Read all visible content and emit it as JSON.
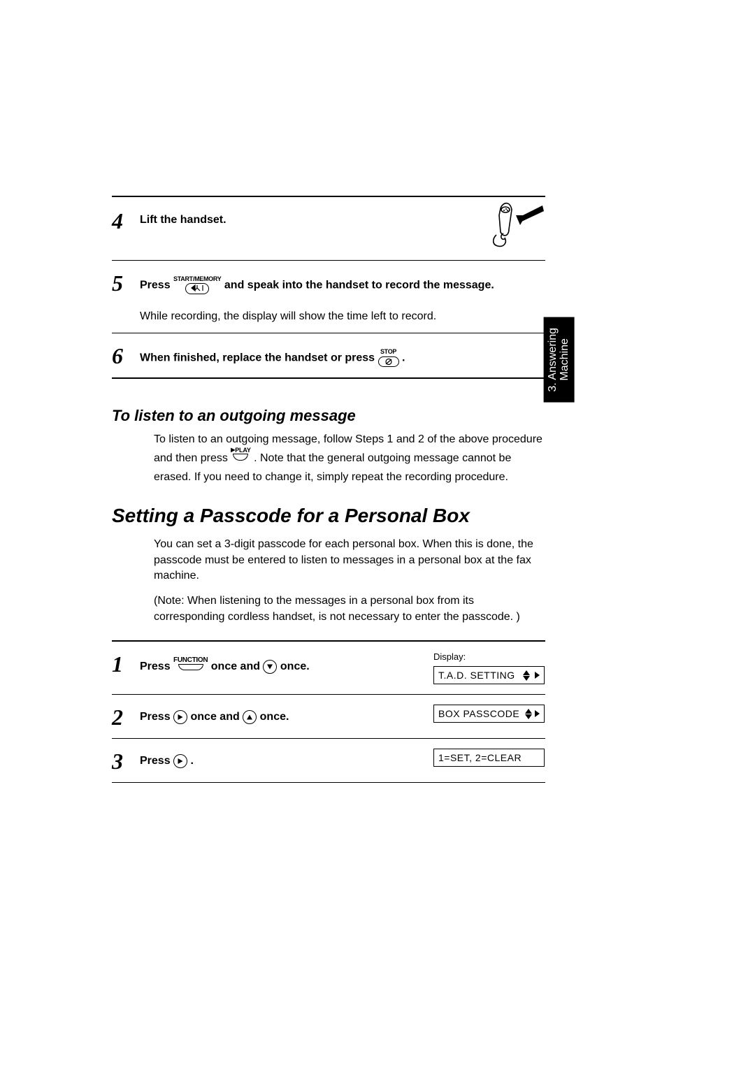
{
  "sideTab": {
    "line1": "3. Answering",
    "line2": "Machine"
  },
  "steps456": {
    "s4": {
      "num": "4",
      "text": "Lift the handset."
    },
    "s5": {
      "num": "5",
      "pre": "Press ",
      "keyLabel": "START/MEMORY",
      "post": " and speak into the handset to record the message.",
      "sub": "While recording, the display will show the time left to record."
    },
    "s6": {
      "num": "6",
      "pre": "When finished, replace the handset or press ",
      "keyLabel": "STOP",
      "post": " ."
    }
  },
  "listenHeading": "To listen to an outgoing message",
  "listenPara": {
    "pre": "To listen to an outgoing message, follow Steps 1 and 2 of the above procedure and then press ",
    "playLabel": "PLAY",
    "post": ". Note that the general outgoing message cannot be erased. If you need to change it, simply repeat the recording procedure."
  },
  "mainHeading": "Setting a Passcode for a Personal Box",
  "mainPara1": "You can set a 3-digit passcode for each personal box. When this is done, the passcode must be entered to listen to messages in a personal box at the fax machine.",
  "mainPara2": "(Note: When listening to the messages in a personal box from its corresponding cordless handset, is not necessary to enter the passcode. )",
  "steps123": {
    "s1": {
      "num": "1",
      "t1": "Press ",
      "funcLabel": "FUNCTION",
      "t2": " once and ",
      "t3": " once.",
      "displayLabel": "Display:",
      "displayText": "T.A.D. SETTING"
    },
    "s2": {
      "num": "2",
      "t1": "Press ",
      "t2": " once and ",
      "t3": " once.",
      "displayText": "BOX PASSCODE"
    },
    "s3": {
      "num": "3",
      "t1": "Press ",
      "t2": " .",
      "displayText": "1=SET, 2=CLEAR"
    }
  }
}
